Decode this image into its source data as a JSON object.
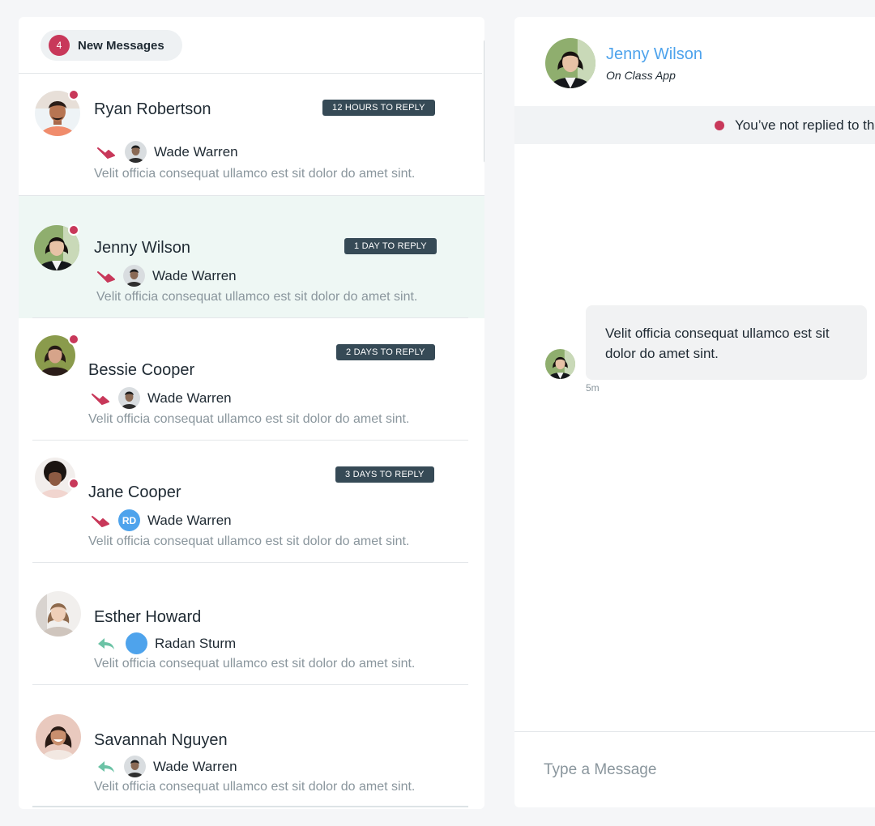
{
  "inbox": {
    "new_count": "4",
    "new_label": "New Messages"
  },
  "conversations": [
    {
      "name": "Ryan Robertson",
      "badge": "12 HOURS TO REPLY",
      "direction": "forward",
      "assignee": "Wade Warren",
      "assignee_avatar": "photo",
      "assignee_initials": "",
      "preview": "Velit officia consequat ullamco est sit dolor do amet sint.",
      "unread": true,
      "selected": false
    },
    {
      "name": "Jenny Wilson",
      "badge": "1 DAY TO REPLY",
      "direction": "forward",
      "assignee": "Wade Warren",
      "assignee_avatar": "photo",
      "assignee_initials": "",
      "preview": "Velit officia consequat ullamco est sit dolor do amet sint.",
      "unread": true,
      "selected": true
    },
    {
      "name": "Bessie Cooper",
      "badge": "2 DAYS TO REPLY",
      "direction": "forward",
      "assignee": "Wade Warren",
      "assignee_avatar": "photo",
      "assignee_initials": "",
      "preview": "Velit officia consequat ullamco est sit dolor do amet sint.",
      "unread": true,
      "selected": false
    },
    {
      "name": "Jane Cooper",
      "badge": "3 DAYS TO REPLY",
      "direction": "forward",
      "assignee": "Wade Warren",
      "assignee_avatar": "initials",
      "assignee_initials": "RD",
      "preview": "Velit officia consequat ullamco est sit dolor do amet sint.",
      "unread": true,
      "selected": false
    },
    {
      "name": "Esther Howard",
      "badge": "",
      "direction": "reply",
      "assignee": "Radan Sturm",
      "assignee_avatar": "blank",
      "assignee_initials": "",
      "preview": "Velit officia consequat ullamco est sit dolor do amet sint.",
      "unread": false,
      "selected": false
    },
    {
      "name": "Savannah Nguyen",
      "badge": "",
      "direction": "reply",
      "assignee": "Wade Warren",
      "assignee_avatar": "photo",
      "assignee_initials": "",
      "preview": "Velit officia consequat ullamco est sit dolor do amet sint.",
      "unread": false,
      "selected": false
    }
  ],
  "chat": {
    "contact_name": "Jenny Wilson",
    "contact_source": "On Class App",
    "notice": "You’ve not replied to th",
    "messages": [
      {
        "text": "Velit officia consequat ullamco est sit dolor do amet sint.",
        "time": "5m"
      }
    ],
    "composer_placeholder": "Type a Message"
  },
  "colors": {
    "accent": "#4ea3ec",
    "alert": "#c8385a",
    "badge_bg": "#364a56",
    "forward_arrow": "#c8385a",
    "reply_arrow": "#6cc3a6",
    "selected_row": "#eef7f4"
  }
}
